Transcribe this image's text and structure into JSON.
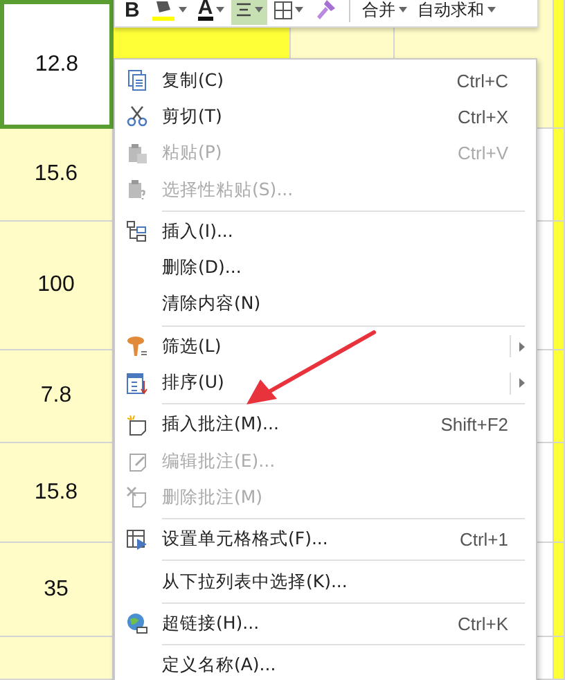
{
  "sheet": {
    "cells": [
      {
        "value": "12.8",
        "selected": true
      },
      {
        "value": "15.6",
        "selected": false
      },
      {
        "value": "100",
        "selected": false
      },
      {
        "value": "7.8",
        "selected": false
      },
      {
        "value": "15.8",
        "selected": false
      },
      {
        "value": "35",
        "selected": false
      }
    ]
  },
  "toolbar": {
    "buttons": [
      {
        "kind": "bold",
        "label": "B",
        "selected": false
      },
      {
        "kind": "fill",
        "selected": false,
        "dropdown": true
      },
      {
        "kind": "font-color",
        "label": "A",
        "selected": false,
        "dropdown": true
      },
      {
        "kind": "align",
        "selected": true,
        "dropdown": true
      },
      {
        "kind": "border",
        "selected": false,
        "dropdown": true
      },
      {
        "kind": "painter",
        "selected": false
      }
    ],
    "menus": [
      {
        "label": "合并"
      },
      {
        "label": "自动求和"
      }
    ]
  },
  "context_menu": {
    "items": [
      {
        "kind": "item",
        "label": "复制(C)",
        "shortcut": "Ctrl+C",
        "disabled": false
      },
      {
        "kind": "item",
        "label": "剪切(T)",
        "shortcut": "Ctrl+X",
        "disabled": false
      },
      {
        "kind": "item",
        "label": "粘贴(P)",
        "shortcut": "Ctrl+V",
        "disabled": true
      },
      {
        "kind": "item",
        "label": "选择性粘贴(S)...",
        "disabled": true
      },
      {
        "kind": "separator"
      },
      {
        "kind": "item",
        "label": "插入(I)...",
        "disabled": false
      },
      {
        "kind": "item",
        "label": "删除(D)...",
        "disabled": false
      },
      {
        "kind": "item",
        "label": "清除内容(N)",
        "disabled": false
      },
      {
        "kind": "separator"
      },
      {
        "kind": "item",
        "label": "筛选(L)",
        "disabled": false,
        "submenu": true
      },
      {
        "kind": "item",
        "label": "排序(U)",
        "disabled": false,
        "submenu": true
      },
      {
        "kind": "separator"
      },
      {
        "kind": "item",
        "label": "插入批注(M)...",
        "shortcut": "Shift+F2",
        "disabled": false
      },
      {
        "kind": "item",
        "label": "编辑批注(E)...",
        "disabled": true
      },
      {
        "kind": "item",
        "label": "删除批注(M)",
        "disabled": true
      },
      {
        "kind": "separator"
      },
      {
        "kind": "item",
        "label": "设置单元格格式(F)...",
        "shortcut": "Ctrl+1",
        "disabled": false
      },
      {
        "kind": "separator"
      },
      {
        "kind": "item",
        "label": "从下拉列表中选择(K)...",
        "disabled": false
      },
      {
        "kind": "separator"
      },
      {
        "kind": "item",
        "label": "超链接(H)...",
        "shortcut": "Ctrl+K",
        "disabled": false
      },
      {
        "kind": "separator"
      },
      {
        "kind": "item",
        "label": "定义名称(A)...",
        "disabled": false
      }
    ]
  }
}
